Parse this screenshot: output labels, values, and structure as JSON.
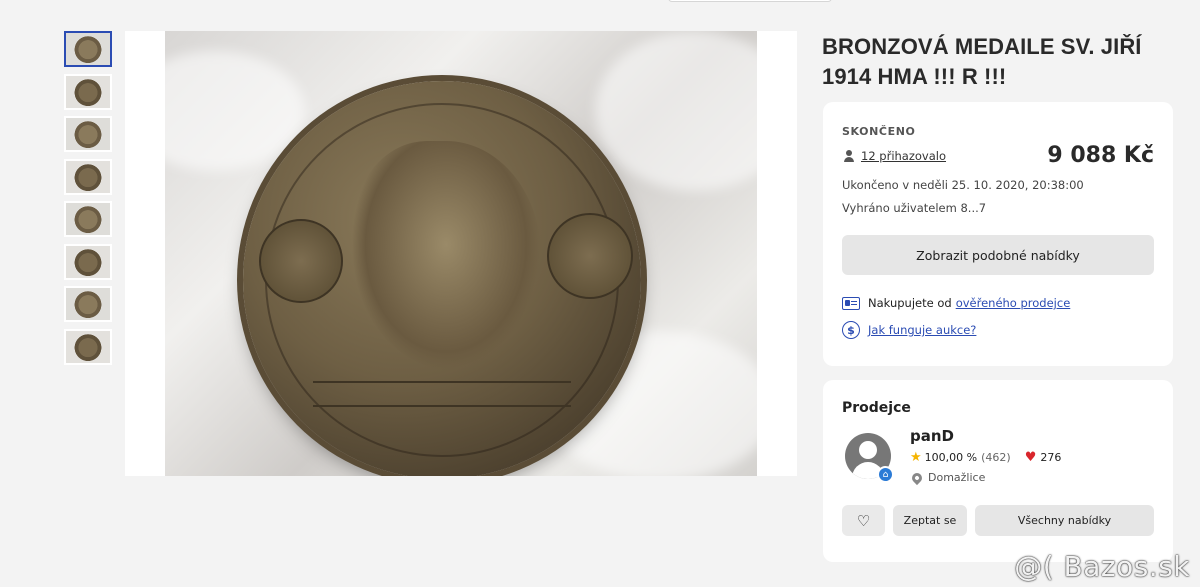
{
  "gallery": {
    "thumbnail_count": 8,
    "active_thumbnail": 1
  },
  "item": {
    "title": "BRONZOVÁ MEDAILE SV. JIŘÍ 1914 HMA !!! R !!!"
  },
  "auction": {
    "status": "SKONČENO",
    "bidders": "12 přihazovalo",
    "price": "9 088 Kč",
    "ended": "Ukončeno v neděli 25. 10. 2020, 20:38:00",
    "winner": "Vyhráno uživatelem 8...7",
    "similar_button": "Zobrazit podobné nabídky",
    "verified_prefix": "Nakupujete od",
    "verified_link": "ověřeného prodejce",
    "help_link": "Jak funguje aukce?"
  },
  "seller": {
    "heading": "Prodejce",
    "name": "panD",
    "rating": "100,00 %",
    "rating_count": "(462)",
    "likes": "276",
    "location": "Domažlice",
    "ask_button": "Zeptat se",
    "all_offers_button": "Všechny nabídky"
  },
  "watermark": "@( Bazos.sk",
  "colors": {
    "accent": "#2b4cb3",
    "star": "#f5b400",
    "heart": "#d9262c",
    "background": "#f3f3f3"
  },
  "icons": {
    "bidders": "person-icon",
    "verified": "id-card-icon",
    "help": "dollar-circle-icon",
    "rating": "star-icon",
    "likes": "heart-icon",
    "location": "pin-icon",
    "favorite": "heart-outline-icon"
  }
}
